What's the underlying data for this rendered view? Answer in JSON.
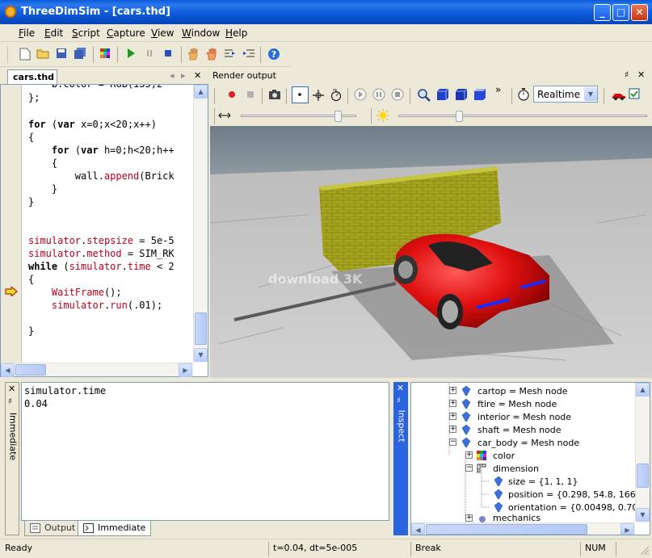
{
  "window": {
    "title": "ThreeDimSim - [cars.thd]",
    "minimize": "_",
    "maximize": "□",
    "close": "✕"
  },
  "menu": [
    {
      "label": "File",
      "key": "F",
      "rest": "ile"
    },
    {
      "label": "Edit",
      "key": "E",
      "rest": "dit"
    },
    {
      "label": "Script",
      "key": "S",
      "rest": "cript"
    },
    {
      "label": "Capture",
      "key": "C",
      "rest": "apture"
    },
    {
      "label": "View",
      "key": "V",
      "rest": "iew"
    },
    {
      "label": "Window",
      "key": "W",
      "rest": "indow"
    },
    {
      "label": "Help",
      "key": "H",
      "rest": "elp"
    }
  ],
  "editor": {
    "tab": "cars.thd",
    "nav_prev": "◂",
    "nav_next": "▸",
    "close": "✕",
    "lines": [
      {
        "t": "    b.color = RGB(135,2"
      },
      {
        "t": "};"
      },
      {
        "t": ""
      },
      {
        "t": "for (var x=0;x<20;x++)"
      },
      {
        "t": "{"
      },
      {
        "t": "    for (var h=0;h<20;h++"
      },
      {
        "t": "    {"
      },
      {
        "t": "        wall.append(Brick"
      },
      {
        "t": "    }"
      },
      {
        "t": "}"
      },
      {
        "t": ""
      },
      {
        "t": ""
      },
      {
        "t": "simulator.stepsize = 5e-5"
      },
      {
        "t": "simulator.method = SIM_RK"
      },
      {
        "t": "while (simulator.time < 2"
      },
      {
        "t": "{"
      },
      {
        "t": "    WaitFrame();"
      },
      {
        "t": "    simulator.run(.01);"
      },
      {
        "t": ""
      },
      {
        "t": "}"
      }
    ]
  },
  "render": {
    "title": "Render output",
    "pin": "♯",
    "close": "✕",
    "mode_select": "Realtime",
    "more": "»",
    "watermark": "download 3K"
  },
  "immediate": {
    "side_label": "Immediate",
    "close": "✕",
    "pin": "♯",
    "lines": [
      "simulator.time",
      "0.04"
    ],
    "tabs": [
      "Output",
      "Immediate"
    ]
  },
  "inspect": {
    "side_label": "Inspect",
    "close": "✕",
    "pin": "♯",
    "nodes": [
      {
        "label": "cartop = Mesh node",
        "expander": "+"
      },
      {
        "label": "ftire = Mesh node",
        "expander": "+"
      },
      {
        "label": "interior = Mesh node",
        "expander": "+"
      },
      {
        "label": "shaft = Mesh node",
        "expander": "+"
      },
      {
        "label": "car_body = Mesh node",
        "expander": "−"
      },
      {
        "label": "color",
        "expander": "+"
      },
      {
        "label": "dimension",
        "expander": "−"
      },
      {
        "label": "size = {1, 1, 1}",
        "expander": ""
      },
      {
        "label": "position = {0.298, 54.8, 166}",
        "expander": ""
      },
      {
        "label": "orientation = {0.00498, 0.707, 0.7",
        "expander": ""
      },
      {
        "label": "mechanics",
        "expander": "+"
      }
    ]
  },
  "status": {
    "ready": "Ready",
    "time": "t=0.04, dt=5e-005",
    "mode": "Break",
    "num": "NUM"
  },
  "colors": {
    "accent": "#0a5ad8",
    "keyword": "#000000",
    "identifier": "#b8001e",
    "car": "#e01010",
    "wall": "#a8a820"
  }
}
